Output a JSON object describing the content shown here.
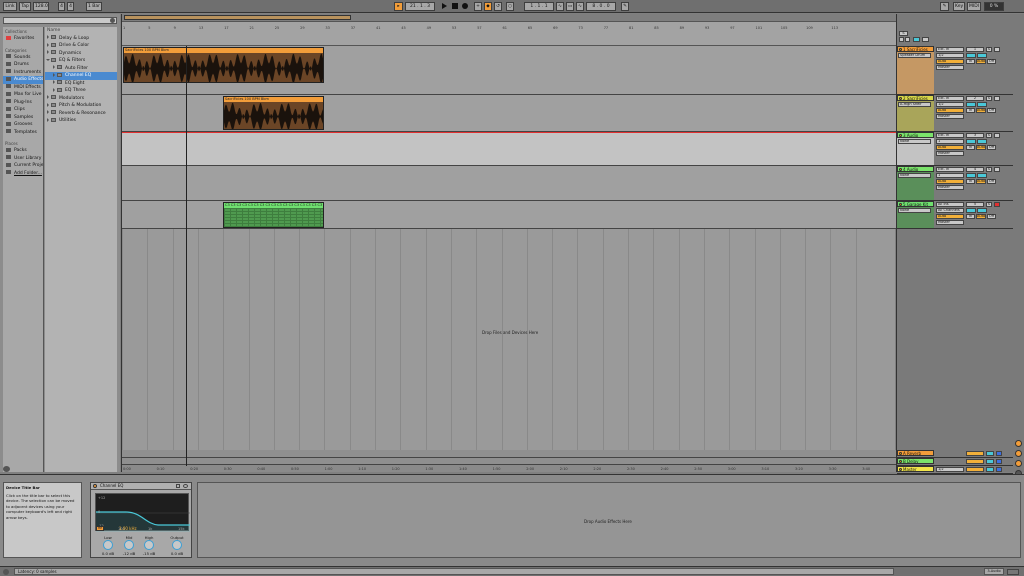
{
  "topbar": {
    "link": "Link",
    "tap": "Tap",
    "tempo": "128.00",
    "sig_num": "4",
    "sig_den": "4",
    "quant": "1 Bar",
    "position": "21 . 1 . 3",
    "loop_start": "1 . 1 . 1",
    "loop_len": "8 . 0 . 0",
    "key": "Key",
    "midi": "MIDI",
    "cpu": "0 %"
  },
  "browser": {
    "collections_header": "Collections",
    "favorites": "Favorites",
    "categories_header": "Categories",
    "categories": [
      "Sounds",
      "Drums",
      "Instruments",
      "Audio Effects",
      "MIDI Effects",
      "Max for Live",
      "Plug-Ins",
      "Clips",
      "Samples",
      "Grooves",
      "Templates"
    ],
    "selected_category": "Audio Effects",
    "places_header": "Places",
    "places": [
      "Packs",
      "User Library",
      "Current Project",
      "Add Folder..."
    ],
    "name_header": "Name",
    "items": [
      {
        "label": "Delay & Loop",
        "depth": 0,
        "open": false
      },
      {
        "label": "Drive & Color",
        "depth": 0,
        "open": false
      },
      {
        "label": "Dynamics",
        "depth": 0,
        "open": false
      },
      {
        "label": "EQ & Filters",
        "depth": 0,
        "open": true
      },
      {
        "label": "Auto Filter",
        "depth": 1,
        "open": false
      },
      {
        "label": "Channel EQ",
        "depth": 1,
        "open": false,
        "selected": true
      },
      {
        "label": "EQ Eight",
        "depth": 1,
        "open": false
      },
      {
        "label": "EQ Three",
        "depth": 1,
        "open": false
      },
      {
        "label": "Modulators",
        "depth": 0,
        "open": false
      },
      {
        "label": "Pitch & Modulation",
        "depth": 0,
        "open": false
      },
      {
        "label": "Reverb & Resonance",
        "depth": 0,
        "open": false
      },
      {
        "label": "Utilities",
        "depth": 0,
        "open": false
      }
    ]
  },
  "arrangement": {
    "bar_ticks": [
      "1",
      "5",
      "9",
      "13",
      "17",
      "21",
      "25",
      "29",
      "33",
      "37",
      "41",
      "45",
      "49",
      "53",
      "57",
      "61",
      "65",
      "69",
      "73",
      "77",
      "81",
      "85",
      "89",
      "93",
      "97",
      "101",
      "105",
      "109",
      "113"
    ],
    "time_ticks": [
      "0:00",
      "0:10",
      "0:20",
      "0:30",
      "0:40",
      "0:50",
      "1:00",
      "1:10",
      "1:20",
      "1:30",
      "1:40",
      "1:50",
      "2:00",
      "2:10",
      "2:20",
      "2:30",
      "2:40",
      "2:50",
      "3:00",
      "3:10",
      "3:20",
      "3:30",
      "3:40"
    ],
    "drop_hint": "Drop Files and Devices Here",
    "clip_label_a": "SacriFicies 100 BPM Bbm",
    "clip_label_b": "SacriFicies 100 BPM Bbm",
    "drum_clip_label": "C3"
  },
  "tracks": [
    {
      "name": "1 SacriFicies",
      "color": "#f29d3a",
      "input": "Ext. In",
      "chan": "1/2",
      "monitor": "Auto",
      "out": "Master",
      "device": "Speaker Drum"
    },
    {
      "name": "2 SacriFicies",
      "color": "#d8d84a",
      "input": "Ext. In",
      "chan": "1/2",
      "monitor": "Auto",
      "out": "Master",
      "device": "A-High Shelf"
    },
    {
      "name": "3 Audio",
      "color": "#7be36b",
      "input": "Ext. In",
      "chan": "1",
      "monitor": "Auto",
      "out": "Master",
      "device": "None"
    },
    {
      "name": "4 Audio",
      "color": "#7be36b",
      "input": "Ext. In",
      "chan": "1",
      "monitor": "Auto",
      "out": "Master",
      "device": "None"
    },
    {
      "name": "5 Garage Kit",
      "color": "#6fe06f",
      "input": "All Ins",
      "chan": "All Channels",
      "monitor": "Auto",
      "out": "Master",
      "device": "None"
    }
  ],
  "returns": [
    {
      "name": "A Reverb",
      "color": "#f29d3a"
    },
    {
      "name": "B Delay",
      "color": "#7be36b"
    },
    {
      "name": "Master",
      "color": "#f2e54a",
      "chan": "1/2"
    }
  ],
  "mixer_labels": {
    "solo": "S",
    "in": "In",
    "auto": "Auto",
    "off": "Off",
    "master": "Master"
  },
  "info": {
    "title": "Device Title Bar",
    "text": "Click on the title bar to select this device. The selection can be moved to adjacent devices using your computer keyboard's left and right arrow keys."
  },
  "device": {
    "name": "Channel EQ",
    "freq_readout": "1.00 kHz",
    "scale_left": [
      "+12",
      "0",
      "-12"
    ],
    "scale_mid": [
      "100",
      "1k"
    ],
    "scale_right": "15k",
    "knobs": [
      {
        "label": "Low",
        "value": "0.0 dB"
      },
      {
        "label": "Mid",
        "value": "-12 dB"
      },
      {
        "label": "High",
        "value": "-15 dB"
      },
      {
        "label": "Output",
        "value": "0.0 dB"
      }
    ],
    "hp_label": "HP"
  },
  "fx_drop": "Drop Audio Effects Here",
  "status": {
    "message": "Latency: 0 samples",
    "track_name": "3-Audio"
  },
  "colors": {
    "orange": "#f29d3a",
    "selection": "#4a8ad0",
    "cyan": "#4ac8d8"
  }
}
